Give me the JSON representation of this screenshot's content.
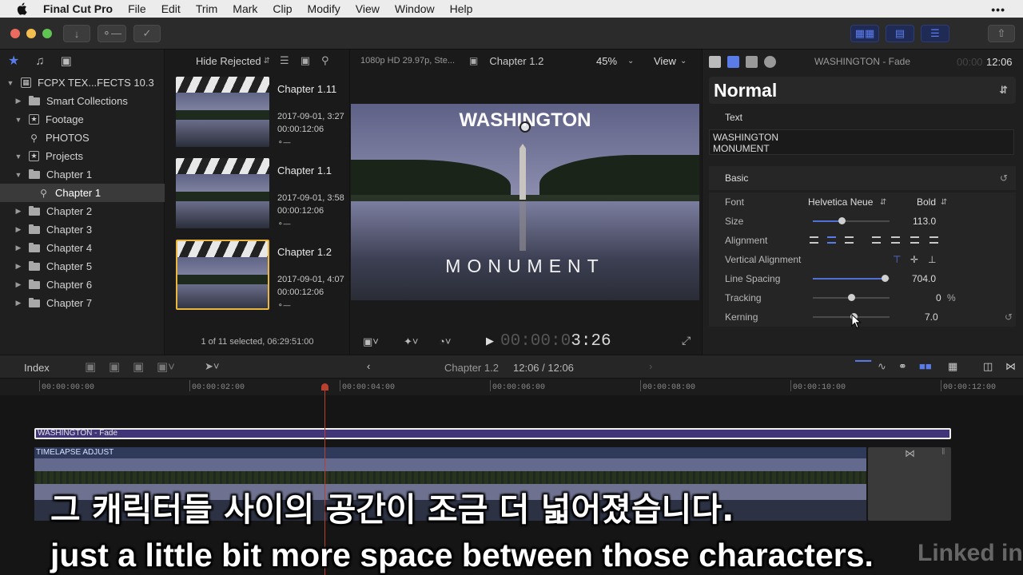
{
  "menubar": {
    "app": "Final Cut Pro",
    "items": [
      "File",
      "Edit",
      "Trim",
      "Mark",
      "Clip",
      "Modify",
      "View",
      "Window",
      "Help"
    ]
  },
  "library": {
    "rows": [
      {
        "label": "FCPX TEX...FECTS 10.3",
        "level": 0,
        "icon": "library-icon",
        "tri": "▼"
      },
      {
        "label": "Smart Collections",
        "level": 1,
        "icon": "folder-icon",
        "tri": "▶"
      },
      {
        "label": "Footage",
        "level": 1,
        "icon": "event-icon",
        "tri": "▼"
      },
      {
        "label": "PHOTOS",
        "level": 2,
        "icon": "keyword-icon",
        "tri": ""
      },
      {
        "label": "Projects",
        "level": 1,
        "icon": "event-icon",
        "tri": "▼"
      },
      {
        "label": "Chapter 1",
        "level": 2,
        "icon": "folder-icon",
        "tri": "▼"
      },
      {
        "label": "Chapter 1",
        "level": 3,
        "icon": "keyword-icon",
        "tri": "",
        "selected": true
      },
      {
        "label": "Chapter 2",
        "level": 2,
        "icon": "folder-icon",
        "tri": "▶"
      },
      {
        "label": "Chapter 3",
        "level": 2,
        "icon": "folder-icon",
        "tri": "▶"
      },
      {
        "label": "Chapter 4",
        "level": 2,
        "icon": "folder-icon",
        "tri": "▶"
      },
      {
        "label": "Chapter 5",
        "level": 2,
        "icon": "folder-icon",
        "tri": "▶"
      },
      {
        "label": "Chapter 6",
        "level": 2,
        "icon": "folder-icon",
        "tri": "▶"
      },
      {
        "label": "Chapter 7",
        "level": 2,
        "icon": "folder-icon",
        "tri": "▶"
      }
    ]
  },
  "browser": {
    "filter": "Hide Rejected",
    "clips": [
      {
        "title": "Chapter 1.11",
        "date": "2017-09-01, 3:27",
        "duration": "00:00:12:06"
      },
      {
        "title": "Chapter 1.1",
        "date": "2017-09-01, 3:58",
        "duration": "00:00:12:06"
      },
      {
        "title": "Chapter 1.2",
        "date": "2017-09-01, 4:07",
        "duration": "00:00:12:06"
      }
    ],
    "status": "1 of 11 selected, 06:29:51:00"
  },
  "viewer": {
    "format": "1080p HD 29.97p, Ste...",
    "project": "Chapter 1.2",
    "zoom": "45%",
    "view_label": "View",
    "title_top": "WASHINGTON",
    "title_bottom": "MONUMENT",
    "timecode_dim": "00:00:0",
    "timecode_lit": "3:26"
  },
  "inspector": {
    "header_title": "WASHINGTON - Fade",
    "header_dur_dim": "00:00",
    "header_dur": "12:06",
    "preset": "Normal",
    "text_label": "Text",
    "text_lines": [
      "WASHINGTON",
      "MONUMENT"
    ],
    "basic_label": "Basic",
    "font_label": "Font",
    "font_value": "Helvetica Neue",
    "weight_value": "Bold",
    "size_label": "Size",
    "size_value": "113.0",
    "alignment_label": "Alignment",
    "valign_label": "Vertical Alignment",
    "spacing_label": "Line Spacing",
    "spacing_value": "704.0",
    "tracking_label": "Tracking",
    "tracking_value": "0",
    "tracking_unit": "%",
    "kerning_label": "Kerning",
    "kerning_value": "7.0"
  },
  "timeline": {
    "index_label": "Index",
    "project": "Chapter 1.2",
    "position": "12:06 / 12:06",
    "ruler": [
      "00:00:00:00",
      "00:00:02:00",
      "00:00:04:00",
      "00:00:06:00",
      "00:00:08:00",
      "00:00:10:00",
      "00:00:12:00"
    ],
    "title_clip": "WASHINGTON - Fade",
    "video_clip": "TIMELAPSE ADJUST"
  },
  "subtitles": {
    "korean": "그 캐릭터들 사이의 공간이 조금 더 넓어졌습니다.",
    "english": "just a little bit more space between those characters."
  },
  "watermark": "Linked in",
  "colors": {
    "accent": "#5a7ce8",
    "selection": "#e8b73c",
    "playhead": "#b9402f",
    "title_clip": "#3f3577"
  }
}
